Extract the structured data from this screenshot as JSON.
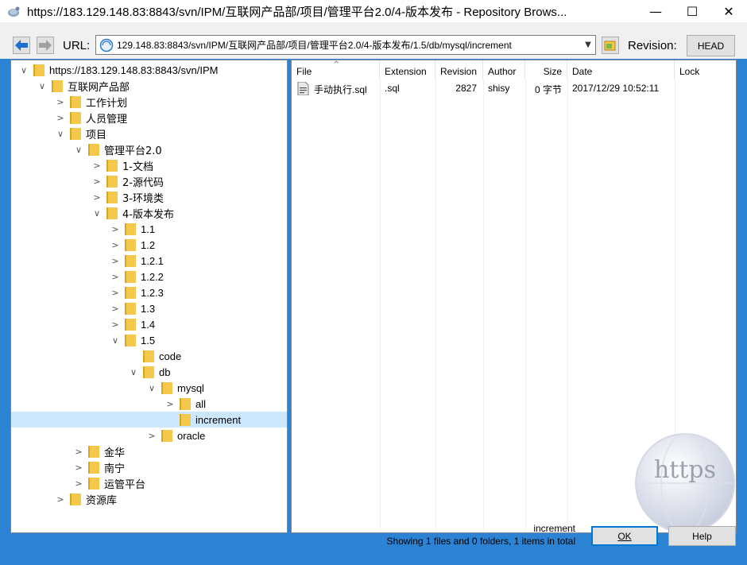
{
  "window": {
    "title": "https://183.129.148.83:8843/svn/IPM/互联网产品部/项目/管理平台2.0/4-版本发布 - Repository Brows...",
    "minimize": "—",
    "maximize": "☐",
    "close": "✕"
  },
  "toolbar": {
    "url_label": "URL:",
    "url_value": "129.148.83:8843/svn/IPM/互联网产品部/项目/管理平台2.0/4-版本发布/1.5/db/mysql/increment",
    "revision_label": "Revision:",
    "revision_value": "HEAD"
  },
  "tree": [
    {
      "label": "https://183.129.148.83:8843/svn/IPM",
      "depth": 0,
      "chev": "∨",
      "selected": false
    },
    {
      "label": "互联网产品部",
      "depth": 1,
      "chev": "∨",
      "selected": false
    },
    {
      "label": "工作计划",
      "depth": 2,
      "chev": ">",
      "selected": false
    },
    {
      "label": "人员管理",
      "depth": 2,
      "chev": ">",
      "selected": false
    },
    {
      "label": "项目",
      "depth": 2,
      "chev": "∨",
      "selected": false
    },
    {
      "label": "管理平台2.0",
      "depth": 3,
      "chev": "∨",
      "selected": false
    },
    {
      "label": "1-文档",
      "depth": 4,
      "chev": ">",
      "selected": false
    },
    {
      "label": "2-源代码",
      "depth": 4,
      "chev": ">",
      "selected": false
    },
    {
      "label": "3-环境类",
      "depth": 4,
      "chev": ">",
      "selected": false
    },
    {
      "label": "4-版本发布",
      "depth": 4,
      "chev": "∨",
      "selected": false
    },
    {
      "label": "1.1",
      "depth": 5,
      "chev": ">",
      "selected": false
    },
    {
      "label": "1.2",
      "depth": 5,
      "chev": ">",
      "selected": false
    },
    {
      "label": "1.2.1",
      "depth": 5,
      "chev": ">",
      "selected": false
    },
    {
      "label": "1.2.2",
      "depth": 5,
      "chev": ">",
      "selected": false
    },
    {
      "label": "1.2.3",
      "depth": 5,
      "chev": ">",
      "selected": false
    },
    {
      "label": "1.3",
      "depth": 5,
      "chev": ">",
      "selected": false
    },
    {
      "label": "1.4",
      "depth": 5,
      "chev": ">",
      "selected": false
    },
    {
      "label": "1.5",
      "depth": 5,
      "chev": "∨",
      "selected": false
    },
    {
      "label": "code",
      "depth": 6,
      "chev": "",
      "selected": false
    },
    {
      "label": "db",
      "depth": 6,
      "chev": "∨",
      "selected": false
    },
    {
      "label": "mysql",
      "depth": 7,
      "chev": "∨",
      "selected": false
    },
    {
      "label": "all",
      "depth": 8,
      "chev": ">",
      "selected": false
    },
    {
      "label": "increment",
      "depth": 8,
      "chev": "",
      "selected": true
    },
    {
      "label": "oracle",
      "depth": 7,
      "chev": ">",
      "selected": false
    },
    {
      "label": "金华",
      "depth": 3,
      "chev": ">",
      "selected": false
    },
    {
      "label": "南宁",
      "depth": 3,
      "chev": ">",
      "selected": false
    },
    {
      "label": "运管平台",
      "depth": 3,
      "chev": ">",
      "selected": false
    },
    {
      "label": "资源库",
      "depth": 2,
      "chev": ">",
      "selected": false
    }
  ],
  "list": {
    "columns": [
      "File",
      "Extension",
      "Revision",
      "Author",
      "Size",
      "Date",
      "Lock"
    ],
    "sort_indicator": "^",
    "rows": [
      {
        "file": "手动执行.sql",
        "extension": ".sql",
        "revision": "2827",
        "author": "shisy",
        "size": "0 字节",
        "date": "2017/12/29 10:52:11",
        "lock": ""
      }
    ]
  },
  "watermark": "https",
  "status": {
    "path": "increment",
    "summary": "Showing 1 files and 0 folders, 1 items in total"
  },
  "buttons": {
    "ok": "OK",
    "help": "Help"
  },
  "colors": {
    "dialog_bg": "#2c82d3",
    "selection": "#cce8ff",
    "folder": "#f4c84b"
  }
}
